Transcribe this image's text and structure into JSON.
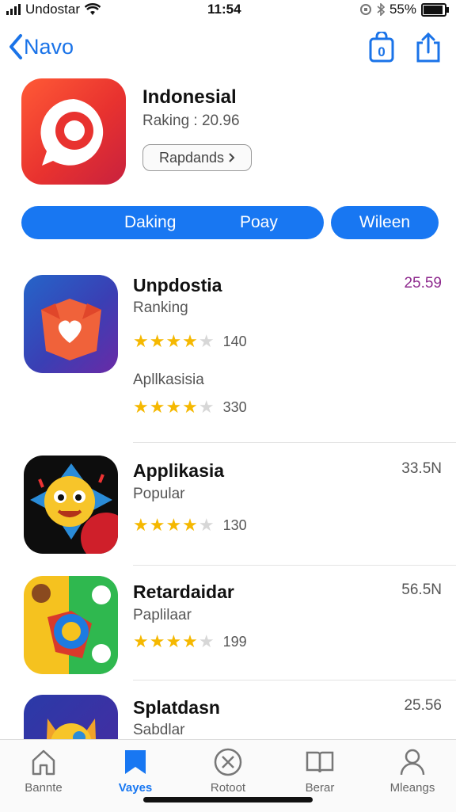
{
  "status": {
    "carrier": "Undostar",
    "time": "11:54",
    "battery": "55%",
    "battery_level": 0.85
  },
  "nav": {
    "back_label": "Navo",
    "badge": "0"
  },
  "hero": {
    "title": "Indonesial",
    "subtitle": "Raking : 20.96",
    "button_label": "Rapdands"
  },
  "segments": {
    "left_1": "Daking",
    "left_2": "Poay",
    "right": "Wileen"
  },
  "apps": [
    {
      "name": "Unpdostia",
      "category": "Ranking",
      "rating": 4,
      "count": "140",
      "price": "25.59",
      "sub_category": "Apllkasisia",
      "sub_rating": 4,
      "sub_count": "330"
    },
    {
      "name": "Applikasia",
      "category": "Popular",
      "rating": 4,
      "count": "130",
      "price": "33.5N"
    },
    {
      "name": "Retardaidar",
      "category": "Paplilaar",
      "rating": 4,
      "count": "199",
      "price": "56.5N"
    },
    {
      "name": "Splatdasn",
      "category": "Sabdlar",
      "price": "25.56"
    }
  ],
  "tabs": [
    {
      "label": "Bannte",
      "icon": "home-icon"
    },
    {
      "label": "Vayes",
      "icon": "bookmark-icon"
    },
    {
      "label": "Rotoot",
      "icon": "close-circle-icon"
    },
    {
      "label": "Berar",
      "icon": "book-icon"
    },
    {
      "label": "Mleangs",
      "icon": "person-icon"
    }
  ],
  "colors": {
    "accent": "#1877f2",
    "star": "#f5b800",
    "price_highlight": "#8e2a8e"
  }
}
